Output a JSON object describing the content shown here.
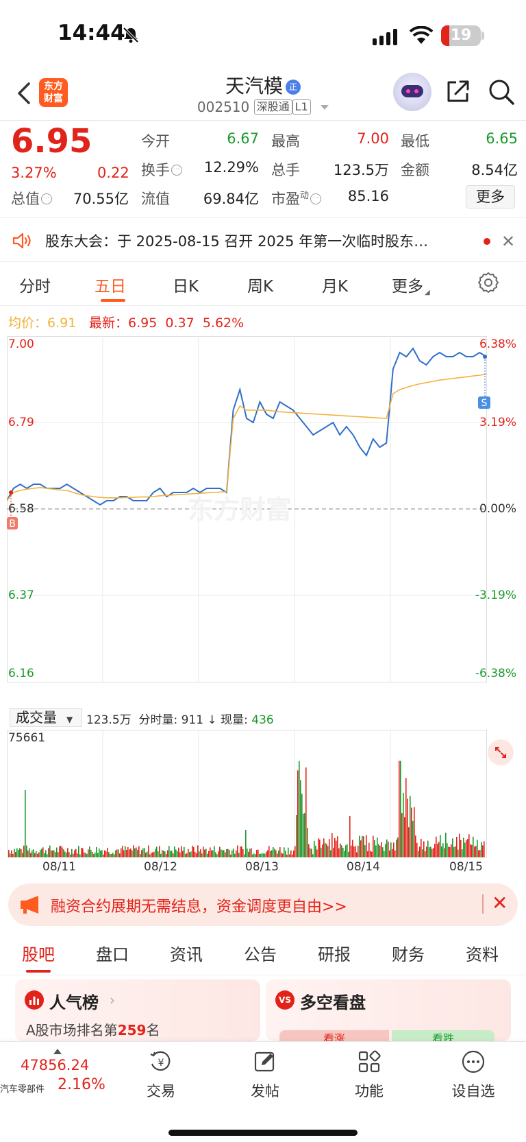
{
  "status_bar": {
    "time": "14:44",
    "battery": "19"
  },
  "header": {
    "logo_line1": "东方",
    "logo_line2": "财富",
    "stock_name": "天汽模",
    "verified_badge": "正",
    "stock_code": "002510",
    "tag_market": "深股通",
    "tag_level": "L1"
  },
  "quote": {
    "price": "6.95",
    "change_pct": "3.27%",
    "change_abs": "0.22",
    "open_label": "今开",
    "open": "6.67",
    "high_label": "最高",
    "high": "7.00",
    "low_label": "最低",
    "low": "6.65",
    "turnover_label": "换手",
    "turnover": "12.29%",
    "volume_label": "总手",
    "volume": "123.5万",
    "amount_label": "金额",
    "amount": "8.54亿",
    "mktcap_label": "总值",
    "mktcap": "70.55亿",
    "float_label": "流值",
    "float": "69.84亿",
    "pe_label": "市盈",
    "pe_sup": "动",
    "pe": "85.16",
    "more_label": "更多"
  },
  "notice": {
    "text": "股东大会：于 2025-08-15 召开 2025 年第一次临时股东…"
  },
  "chart_tabs": [
    "分时",
    "五日",
    "日K",
    "周K",
    "月K",
    "更多"
  ],
  "legend": {
    "avg_label": "均价：",
    "avg": "6.91",
    "latest_label": "最新：",
    "latest": "6.95",
    "latest_chg": "0.37",
    "latest_pct": "5.62%"
  },
  "chart_data": {
    "type": "line",
    "y_left_ticks": [
      "7.00",
      "6.79",
      "6.58",
      "6.37",
      "6.16"
    ],
    "y_right_ticks": [
      "6.38%",
      "3.19%",
      "0.00%",
      "-3.19%",
      "-6.38%"
    ],
    "ylim": [
      6.16,
      7.0
    ],
    "prev_close": 6.58,
    "x_days": [
      "08/11",
      "08/12",
      "08/13",
      "08/14",
      "08/15"
    ],
    "watermark": "东方财富",
    "markers": {
      "buy": "B",
      "sell": "S"
    },
    "series": [
      {
        "name": "最新",
        "color": "#2f6fca",
        "values": [
          6.6,
          6.63,
          6.64,
          6.63,
          6.64,
          6.64,
          6.63,
          6.63,
          6.63,
          6.64,
          6.63,
          6.62,
          6.61,
          6.6,
          6.59,
          6.6,
          6.6,
          6.61,
          6.61,
          6.6,
          6.6,
          6.6,
          6.62,
          6.63,
          6.61,
          6.62,
          6.62,
          6.62,
          6.63,
          6.62,
          6.63,
          6.63,
          6.63,
          6.62,
          6.82,
          6.87,
          6.8,
          6.79,
          6.84,
          6.81,
          6.8,
          6.84,
          6.83,
          6.82,
          6.8,
          6.78,
          6.76,
          6.77,
          6.78,
          6.79,
          6.76,
          6.78,
          6.76,
          6.73,
          6.71,
          6.75,
          6.73,
          6.74,
          6.92,
          6.96,
          6.95,
          6.97,
          6.94,
          6.93,
          6.95,
          6.96,
          6.95,
          6.95,
          6.96,
          6.95,
          6.95,
          6.96,
          6.95
        ]
      },
      {
        "name": "均价",
        "color": "#f3b23a",
        "values": [
          6.6,
          6.62,
          6.625,
          6.628,
          6.63,
          6.632,
          6.63,
          6.628,
          6.626,
          6.625,
          6.62,
          6.615,
          6.612,
          6.61,
          6.608,
          6.607,
          6.607,
          6.607,
          6.608,
          6.608,
          6.609,
          6.609,
          6.61,
          6.612,
          6.613,
          6.614,
          6.615,
          6.616,
          6.617,
          6.618,
          6.619,
          6.62,
          6.621,
          6.622,
          6.8,
          6.83,
          6.82,
          6.82,
          6.82,
          6.82,
          6.818,
          6.816,
          6.815,
          6.814,
          6.813,
          6.812,
          6.811,
          6.81,
          6.809,
          6.808,
          6.807,
          6.806,
          6.805,
          6.804,
          6.803,
          6.802,
          6.801,
          6.8,
          6.86,
          6.87,
          6.875,
          6.88,
          6.884,
          6.887,
          6.89,
          6.893,
          6.895,
          6.897,
          6.899,
          6.901,
          6.903,
          6.905,
          6.907
        ]
      }
    ]
  },
  "volume": {
    "select_label": "成交量",
    "total": "123.5万",
    "minute_label": "分时量:",
    "minute": "911",
    "current_label": "现量:",
    "current": "436",
    "max_tick": "75661"
  },
  "promo": {
    "text": "融资合约展期无需结息，资金调度更自由>>"
  },
  "section_tabs": [
    "股吧",
    "盘口",
    "资讯",
    "公告",
    "研报",
    "财务",
    "资料"
  ],
  "cards": {
    "popularity_title": "人气榜",
    "popularity_sub_prefix": "A股市场排名第",
    "popularity_rank": "259",
    "popularity_sub_suffix": "名",
    "bullbear_title": "多空看盘",
    "bull_label": "看涨",
    "bear_label": "看跌"
  },
  "bottom_nav": {
    "index_value": "47856.24",
    "index_name": "汽车零部件",
    "index_pct": "2.16%",
    "items": [
      "交易",
      "发帖",
      "功能",
      "设自选"
    ]
  },
  "colors": {
    "up": "#e2231a",
    "down": "#1a9a2a",
    "accent": "#ff5a1f",
    "price_line": "#2f6fca",
    "avg_line": "#f3b23a"
  }
}
